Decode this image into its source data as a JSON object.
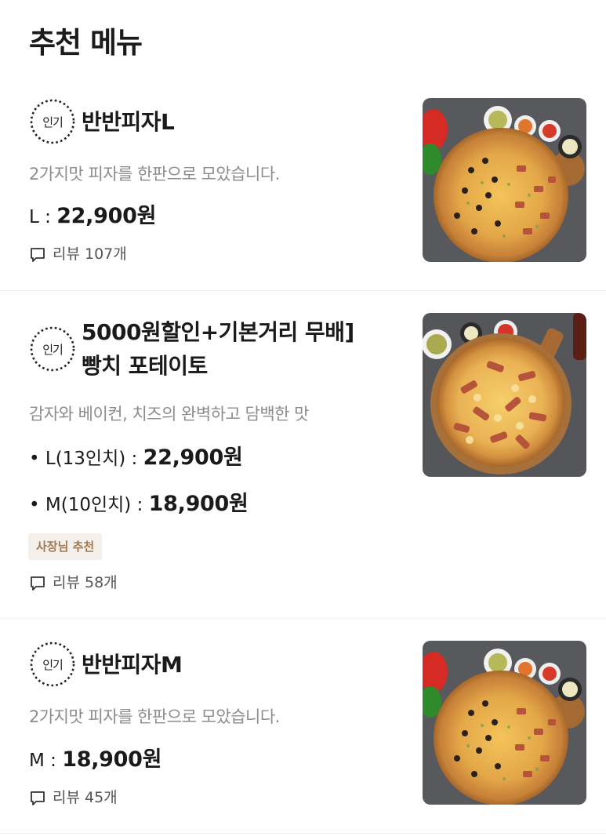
{
  "section": {
    "title": "추천 메뉴"
  },
  "colors": {
    "tag_bg": "#f4efea",
    "tag_text": "#a07a57",
    "desc_text": "#8c8c8c"
  },
  "menu": [
    {
      "badge": "인기",
      "name_lines": [
        "반반피자L"
      ],
      "description": "2가지맛 피자를 한판으로 모았습니다.",
      "prices": [
        {
          "label": "L : ",
          "value": "22,900원"
        }
      ],
      "tag": "",
      "review": "리뷰 107개",
      "image": "half-half-pizza-photo"
    },
    {
      "badge": "인기",
      "name_lines": [
        "5000원할인+기본거리 무배]",
        "빵치 포테이토"
      ],
      "description": "감자와 베이컨, 치즈의 완벽하고 담백한 맛",
      "prices": [
        {
          "label": "• L(13인치) : ",
          "value": "22,900원"
        },
        {
          "label": "• M(10인치) : ",
          "value": "18,900원"
        }
      ],
      "tag": "사장님 추천",
      "review": "리뷰 58개",
      "image": "potato-bacon-pizza-photo"
    },
    {
      "badge": "인기",
      "name_lines": [
        "반반피자M"
      ],
      "description": "2가지맛 피자를 한판으로 모았습니다.",
      "prices": [
        {
          "label": "M : ",
          "value": "18,900원"
        }
      ],
      "tag": "",
      "review": "리뷰 45개",
      "image": "half-half-pizza-photo"
    }
  ]
}
